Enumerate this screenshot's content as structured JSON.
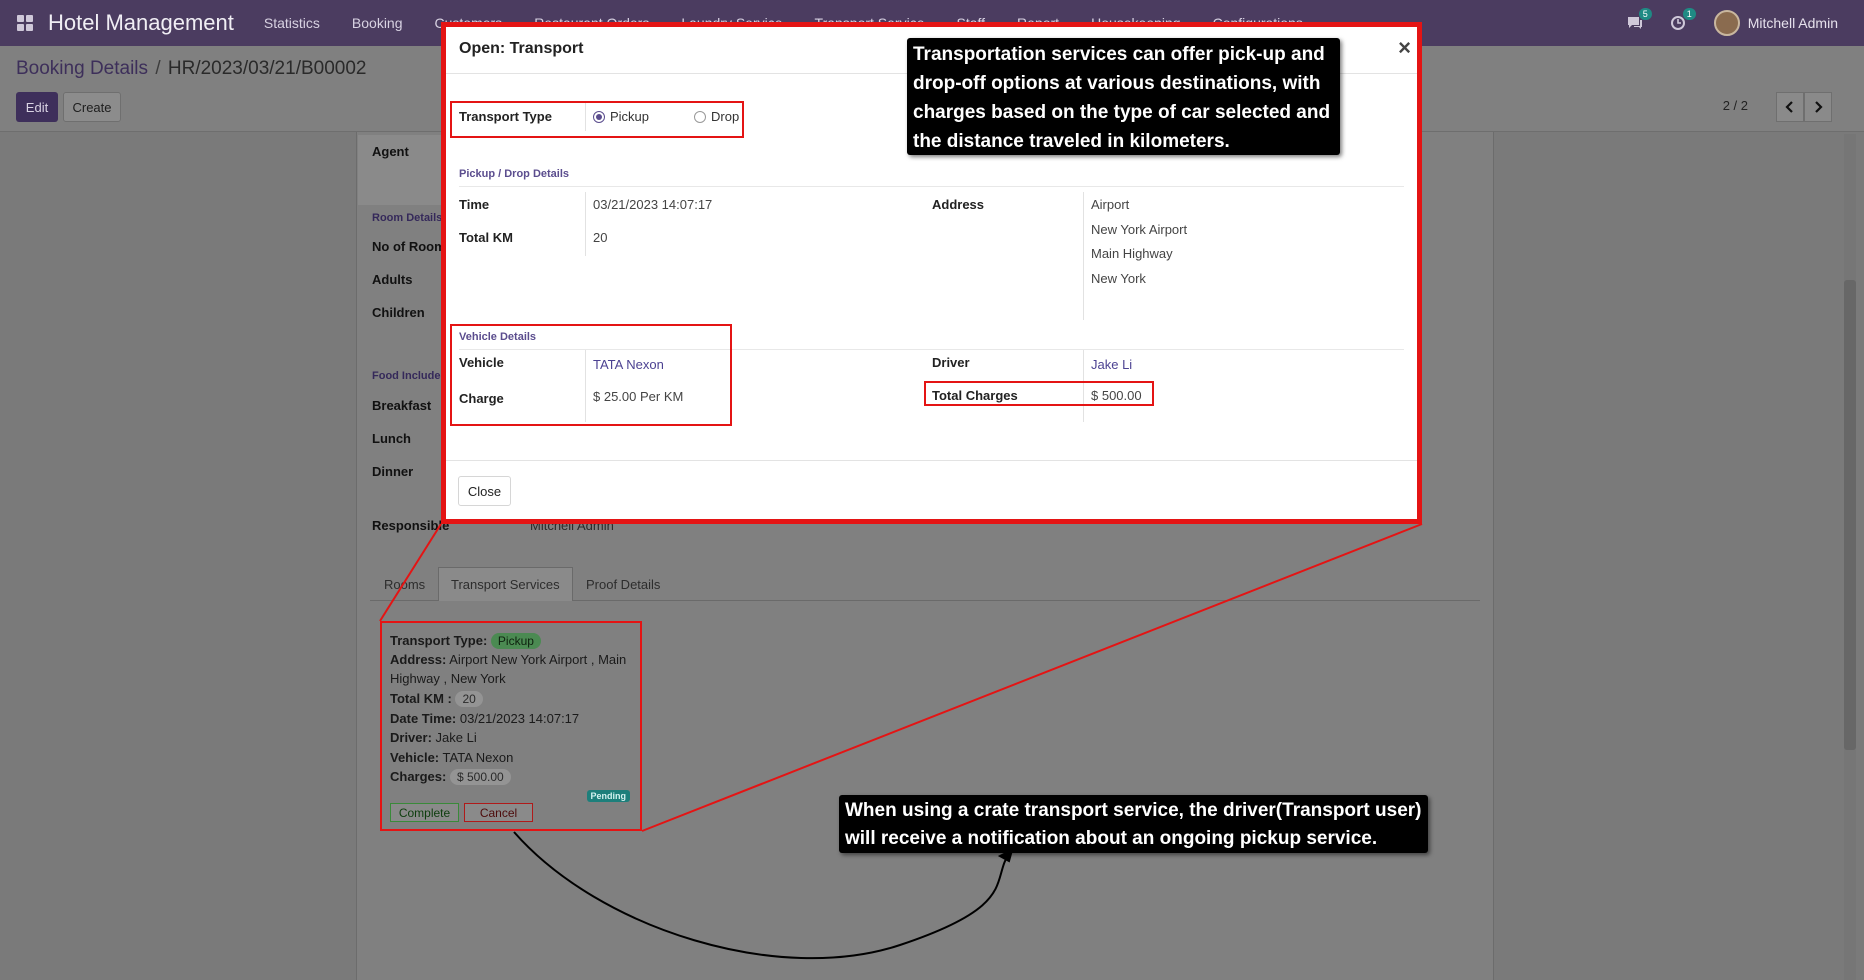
{
  "navbar": {
    "app_title": "Hotel Management",
    "menu": [
      "Statistics",
      "Booking",
      "Customers",
      "Restaurant Orders",
      "Laundry Service",
      "Transport Service",
      "Staff",
      "Report",
      "Housekeeping",
      "Configurations"
    ],
    "chat_badge": "5",
    "activity_badge": "1",
    "user_name": "Mitchell Admin"
  },
  "control_panel": {
    "breadcrumb_parent": "Booking Details",
    "breadcrumb_sep": "/",
    "breadcrumb_current": "HR/2023/03/21/B00002",
    "edit_label": "Edit",
    "create_label": "Create",
    "pager": "2 / 2"
  },
  "form": {
    "agent_label": "Agent",
    "room_details_section": "Room Details",
    "no_of_rooms_label": "No of Rooms",
    "adults_label": "Adults",
    "children_label": "Children",
    "food_included_section": "Food Included",
    "breakfast_label": "Breakfast",
    "lunch_label": "Lunch",
    "dinner_label": "Dinner",
    "responsible_label": "Responsible",
    "responsible_value": "Mitchell Admin",
    "tabs": [
      "Rooms",
      "Transport Services",
      "Proof Details"
    ]
  },
  "transport_card": {
    "type_label": "Transport Type:",
    "type_value": "Pickup",
    "address_label": "Address:",
    "address_line1": "Airport New York Airport , Main",
    "address_line2": "Highway , New York",
    "total_km_label": "Total KM :",
    "total_km_value": "20",
    "datetime_label": "Date Time:",
    "datetime_value": "03/21/2023 14:07:17",
    "driver_label": "Driver:",
    "driver_value": "Jake Li",
    "vehicle_label": "Vehicle:",
    "vehicle_value": "TATA Nexon",
    "charges_label": "Charges:",
    "charges_value": "$ 500.00",
    "status_badge": "Pending",
    "complete_label": "Complete",
    "cancel_label": "Cancel"
  },
  "modal": {
    "title": "Open: Transport",
    "close_glyph": "×",
    "transport_type_label": "Transport Type",
    "radio_options": [
      "Pickup",
      "Drop"
    ],
    "selected_option": "Pickup",
    "pickup_section": "Pickup / Drop Details",
    "time_label": "Time",
    "time_value": "03/21/2023 14:07:17",
    "total_km_label": "Total KM",
    "total_km_value": "20",
    "address_label": "Address",
    "address_lines": [
      "Airport",
      "New York Airport",
      "Main Highway",
      "New York"
    ],
    "vehicle_section": "Vehicle Details",
    "vehicle_label": "Vehicle",
    "vehicle_value": "TATA Nexon",
    "charge_label": "Charge",
    "charge_value": "$ 25.00 Per KM",
    "driver_label": "Driver",
    "driver_value": "Jake Li",
    "total_charges_label": "Total Charges",
    "total_charges_value": "$ 500.00",
    "close_button": "Close"
  },
  "callouts": {
    "top_lines": [
      "Transportation services can offer pick-up and",
      "drop-off options at various destinations, with",
      "charges based on the type of car selected and",
      " the distance traveled in kilometers."
    ],
    "bottom_lines": [
      "When using a crate transport service, the driver(Transport user)",
      "will receive a notification about an ongoing pickup service."
    ]
  },
  "colors": {
    "navbar": "#4b3c60",
    "highlight": "#e41414",
    "primary": "#5b4d8e",
    "link": "#4c4292"
  }
}
